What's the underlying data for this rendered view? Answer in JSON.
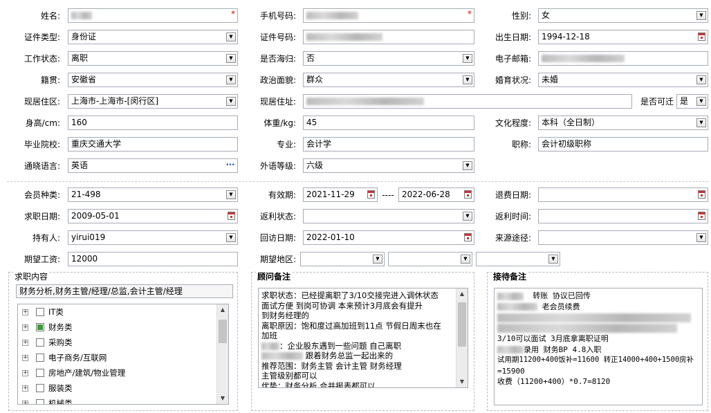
{
  "row1": {
    "name_label": "姓名:",
    "name_value": "",
    "mobile_label": "手机号码:",
    "mobile_value": "",
    "gender_label": "性别:",
    "gender_value": "女"
  },
  "row2": {
    "idtype_label": "证件类型:",
    "idtype_value": "身份证",
    "idno_label": "证件号码:",
    "idno_value": "",
    "birth_label": "出生日期:",
    "birth_value": "1994-12-18"
  },
  "row3": {
    "workstatus_label": "工作状态:",
    "workstatus_value": "离职",
    "returnee_label": "是否海归:",
    "returnee_value": "否",
    "email_label": "电子邮箱:",
    "email_value": ""
  },
  "row4": {
    "native_label": "籍贯:",
    "native_value": "安徽省",
    "political_label": "政治面貌:",
    "political_value": "群众",
    "marital_label": "婚育状况:",
    "marital_value": "未婚"
  },
  "row5": {
    "district_label": "现居住区:",
    "district_value": "上海市-上海市-[闵行区]",
    "address_label": "现居住址:",
    "address_value": "",
    "relocate_label": "是否可迁",
    "relocate_value": "是"
  },
  "row6": {
    "height_label": "身高/cm:",
    "height_value": "160",
    "weight_label": "体重/kg:",
    "weight_value": "45",
    "education_label": "文化程度:",
    "education_value": "本科（全日制）"
  },
  "row7": {
    "school_label": "毕业院校:",
    "school_value": "重庆交通大学",
    "major_label": "专业:",
    "major_value": "会计学",
    "title_label": "职称:",
    "title_value": "会计初级职称"
  },
  "row8": {
    "language_label": "通晓语言:",
    "language_value": "英语",
    "language_more": "•••",
    "langlevel_label": "外语等级:",
    "langlevel_value": "六级"
  },
  "row9": {
    "membertype_label": "会员种类:",
    "membertype_value": "21-498",
    "validity_label": "有效期:",
    "validity_start": "2021-11-29",
    "validity_sep": "----",
    "validity_end": "2022-06-28",
    "refund_label": "退费日期:",
    "refund_value": ""
  },
  "row10": {
    "jobdate_label": "求职日期:",
    "jobdate_value": "2009-05-01",
    "rebate_label": "返利状态:",
    "rebate_value": "",
    "rebatetime_label": "返利时间:",
    "rebatetime_value": ""
  },
  "row11": {
    "holder_label": "持有人:",
    "holder_value": "yirui019",
    "visit_label": "回访日期:",
    "visit_value": "2022-01-10",
    "source_label": "来源途径:",
    "source_value": ""
  },
  "row12": {
    "salary_label": "期望工资:",
    "salary_value": "12000",
    "area_label": "期望地区:"
  },
  "job_panel": {
    "title": "求职内容",
    "summary": "财务分析,财务主管/经理/总监,会计主管/经理",
    "tree": [
      {
        "label": "IT类",
        "checked": false
      },
      {
        "label": "财务类",
        "checked": true
      },
      {
        "label": "采购类",
        "checked": false
      },
      {
        "label": "电子商务/互联网",
        "checked": false
      },
      {
        "label": "房地产/建筑/物业管理",
        "checked": false
      },
      {
        "label": "服装类",
        "checked": false
      },
      {
        "label": "机械类",
        "checked": false
      }
    ]
  },
  "consult_panel": {
    "title": "顾问备注",
    "lines": [
      "求职状态：已经提离职了3/10交接完进入调休状态",
      "面试方便  到岗可协调   本来预计3月底会有提升",
      "到财务经理的",
      "离职原因：饱和度过高加班到11点 节假日周末也在",
      "加班",
      "：企业股东遇到一些问题  自己离职",
      "    跟着财务总监一起出来的",
      "推荐范围：财务主管 会计主管 财务经理",
      "主管级别都可以",
      "优势：财务分析  合并报表都可以"
    ]
  },
  "reception_panel": {
    "title": "接待备注",
    "line1": "转账  协议已回传",
    "line2": "老会员续费",
    "line3": "3/10可以面试 3月底拿离职证明",
    "line4": "录用  财务BP 4.8入职",
    "line5": "试用期11200+400饭补=11600 转正14000+400+1500房补",
    "line6": "=15900",
    "line7": "收费（11200+400）*0.7=8120"
  }
}
